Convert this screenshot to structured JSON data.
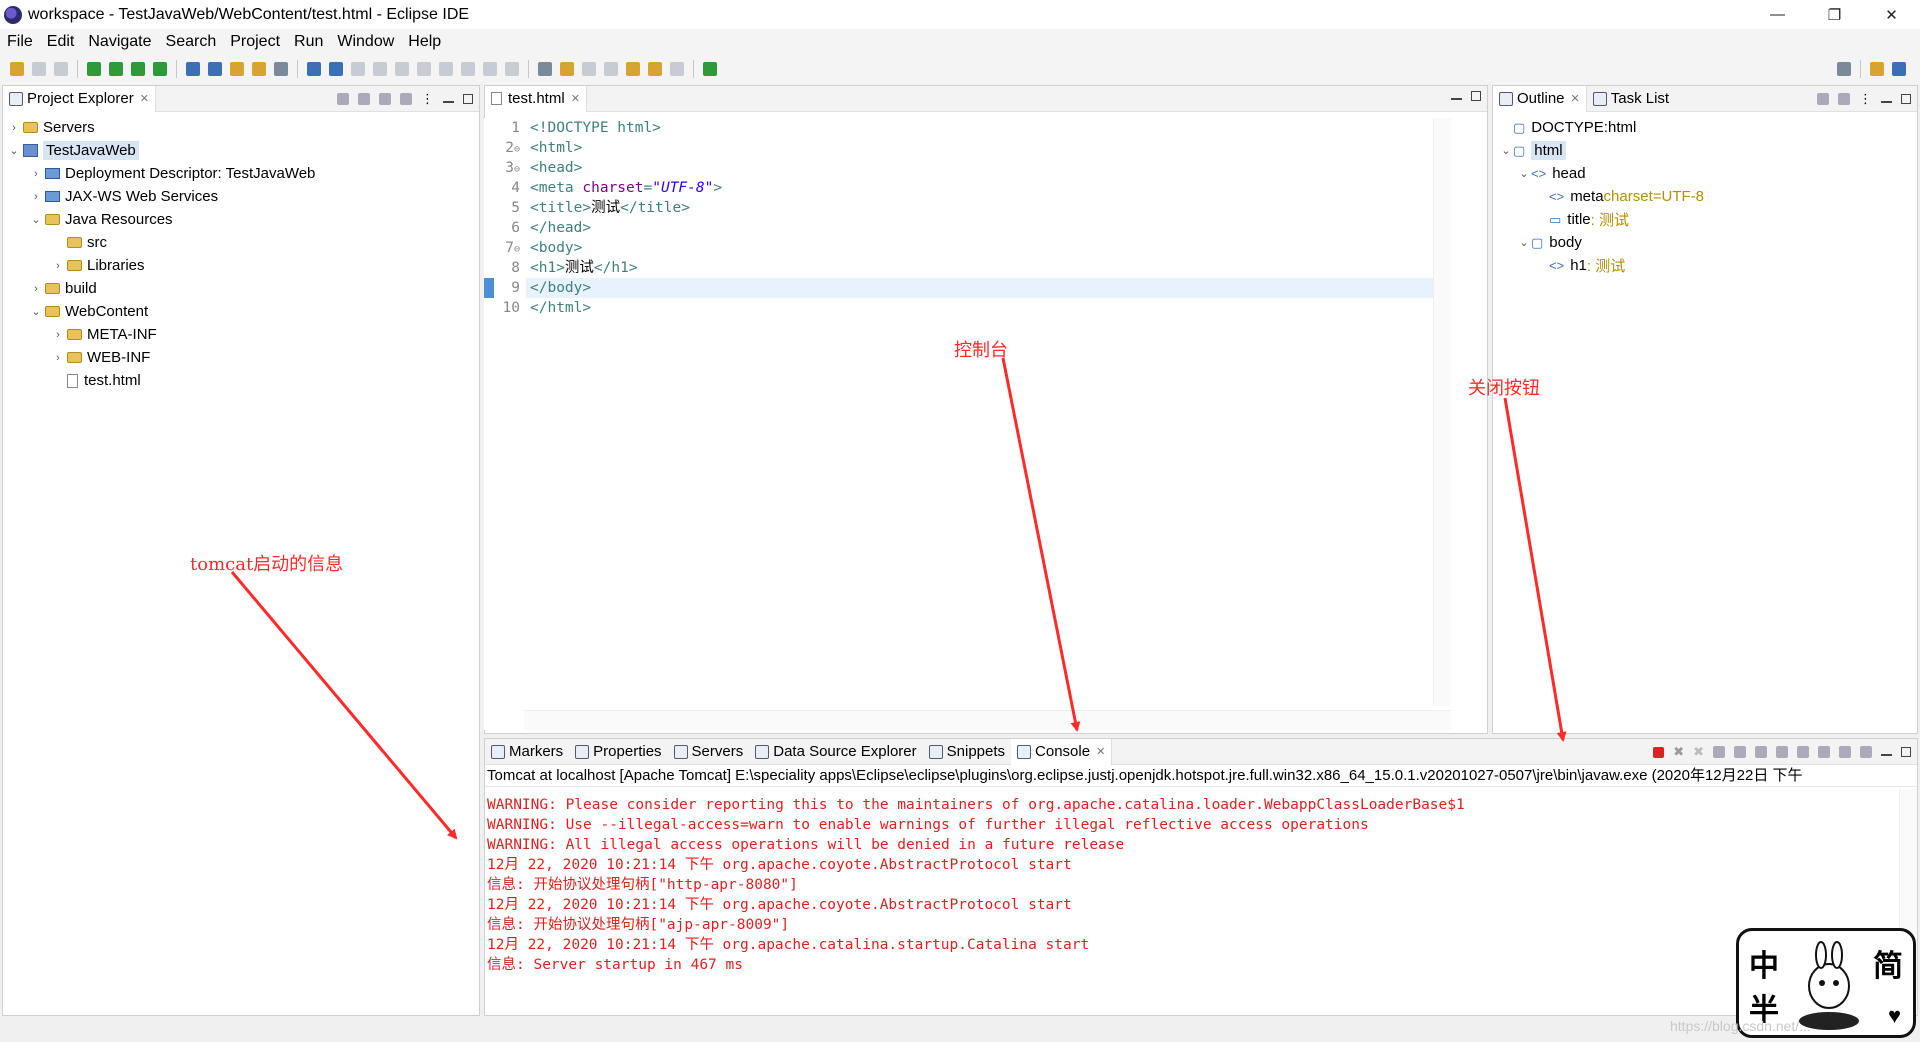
{
  "window": {
    "title": "workspace - TestJavaWeb/WebContent/test.html - Eclipse IDE",
    "minimize": "—",
    "restore": "❐",
    "close": "✕"
  },
  "menu": [
    "File",
    "Edit",
    "Navigate",
    "Search",
    "Project",
    "Run",
    "Window",
    "Help"
  ],
  "project_explorer": {
    "tab_label": "Project Explorer",
    "items": [
      {
        "label": "Servers",
        "indent": 0,
        "caret": "›",
        "icon": "folder-icon"
      },
      {
        "label": "TestJavaWeb",
        "indent": 0,
        "caret": "⌄",
        "icon": "project-icon",
        "selected": true
      },
      {
        "label": "Deployment Descriptor: TestJavaWeb",
        "indent": 1,
        "caret": "›",
        "icon": "descriptor-icon"
      },
      {
        "label": "JAX-WS Web Services",
        "indent": 1,
        "caret": "›",
        "icon": "webservice-icon"
      },
      {
        "label": "Java Resources",
        "indent": 1,
        "caret": "⌄",
        "icon": "folder-icon"
      },
      {
        "label": "src",
        "indent": 2,
        "caret": "",
        "icon": "folder-icon"
      },
      {
        "label": "Libraries",
        "indent": 2,
        "caret": "›",
        "icon": "library-icon"
      },
      {
        "label": "build",
        "indent": 1,
        "caret": "›",
        "icon": "folder-icon"
      },
      {
        "label": "WebContent",
        "indent": 1,
        "caret": "⌄",
        "icon": "folder-icon"
      },
      {
        "label": "META-INF",
        "indent": 2,
        "caret": "›",
        "icon": "folder-icon"
      },
      {
        "label": "WEB-INF",
        "indent": 2,
        "caret": "›",
        "icon": "folder-icon"
      },
      {
        "label": "test.html",
        "indent": 2,
        "caret": "",
        "icon": "file-icon"
      }
    ]
  },
  "editor": {
    "tab_label": "test.html",
    "lines": [
      {
        "num": "1",
        "fold": "",
        "parts": [
          {
            "c": "tag",
            "t": "<!DOCTYPE html>"
          }
        ]
      },
      {
        "num": "2",
        "fold": "⊖",
        "parts": [
          {
            "c": "tag",
            "t": "<html>"
          }
        ]
      },
      {
        "num": "3",
        "fold": "⊖",
        "parts": [
          {
            "c": "tag",
            "t": "<head>"
          }
        ]
      },
      {
        "num": "4",
        "fold": "",
        "parts": [
          {
            "c": "tag",
            "t": "<meta "
          },
          {
            "c": "attr",
            "t": "charset"
          },
          {
            "c": "tag",
            "t": "="
          },
          {
            "c": "val",
            "t": "\"UTF-8\""
          },
          {
            "c": "tag",
            "t": ">"
          }
        ]
      },
      {
        "num": "5",
        "fold": "",
        "parts": [
          {
            "c": "tag",
            "t": "<title>"
          },
          {
            "c": "txt",
            "t": "测试"
          },
          {
            "c": "tag",
            "t": "</title>"
          }
        ]
      },
      {
        "num": "6",
        "fold": "",
        "parts": [
          {
            "c": "tag",
            "t": "</head>"
          }
        ]
      },
      {
        "num": "7",
        "fold": "⊖",
        "parts": [
          {
            "c": "tag",
            "t": "<body>"
          }
        ]
      },
      {
        "num": "8",
        "fold": "",
        "parts": [
          {
            "c": "tag",
            "t": "<h1>"
          },
          {
            "c": "txt",
            "t": "测试"
          },
          {
            "c": "tag",
            "t": "</h1>"
          }
        ]
      },
      {
        "num": "9",
        "fold": "",
        "current": true,
        "parts": [
          {
            "c": "tag",
            "t": "</body>"
          }
        ]
      },
      {
        "num": "10",
        "fold": "",
        "parts": [
          {
            "c": "tag",
            "t": "</html>"
          }
        ]
      }
    ]
  },
  "outline": {
    "tab_label": "Outline",
    "task_tab_label": "Task List",
    "items": [
      {
        "caret": "",
        "indent": 0,
        "icon": "doctype-icon",
        "label": "DOCTYPE:html",
        "extra": ""
      },
      {
        "caret": "⌄",
        "indent": 0,
        "icon": "html-element-icon",
        "label": "html",
        "extra": "",
        "selected": true
      },
      {
        "caret": "⌄",
        "indent": 1,
        "icon": "element-icon",
        "label": "head",
        "extra": ""
      },
      {
        "caret": "",
        "indent": 2,
        "icon": "element-icon",
        "label": "meta",
        "extra": " charset=UTF-8"
      },
      {
        "caret": "",
        "indent": 2,
        "icon": "title-icon",
        "label": "title",
        "extra": " : 测试"
      },
      {
        "caret": "⌄",
        "indent": 1,
        "icon": "body-icon",
        "label": "body",
        "extra": ""
      },
      {
        "caret": "",
        "indent": 2,
        "icon": "element-icon",
        "label": "h1",
        "extra": " : 测试"
      }
    ]
  },
  "bottom_tabs": [
    "Markers",
    "Properties",
    "Servers",
    "Data Source Explorer",
    "Snippets",
    "Console"
  ],
  "console": {
    "process": "Tomcat at localhost [Apache Tomcat] E:\\speciality apps\\Eclipse\\eclipse\\plugins\\org.eclipse.justj.openjdk.hotspot.jre.full.win32.x86_64_15.0.1.v20201027-0507\\jre\\bin\\javaw.exe  (2020年12月22日 下午",
    "lines": [
      "WARNING: Please consider reporting this to the maintainers of org.apache.catalina.loader.WebappClassLoaderBase$1",
      "WARNING: Use --illegal-access=warn to enable warnings of further illegal reflective access operations",
      "WARNING: All illegal access operations will be denied in a future release",
      "12月 22, 2020 10:21:14 下午 org.apache.coyote.AbstractProtocol start",
      "信息: 开始协议处理句柄[\"http-apr-8080\"]",
      "12月 22, 2020 10:21:14 下午 org.apache.coyote.AbstractProtocol start",
      "信息: 开始协议处理句柄[\"ajp-apr-8009\"]",
      "12月 22, 2020 10:21:14 下午 org.apache.catalina.startup.Catalina start",
      "信息: Server startup in 467 ms"
    ]
  },
  "annotations": {
    "console": "控制台",
    "close_button": "关闭按钮",
    "tomcat_info": "tomcat启动的信息"
  },
  "sticker": {
    "top_left": "中",
    "top_right": "简",
    "bottom_left": "半"
  },
  "watermark": "https://blog.csdn.net/..."
}
